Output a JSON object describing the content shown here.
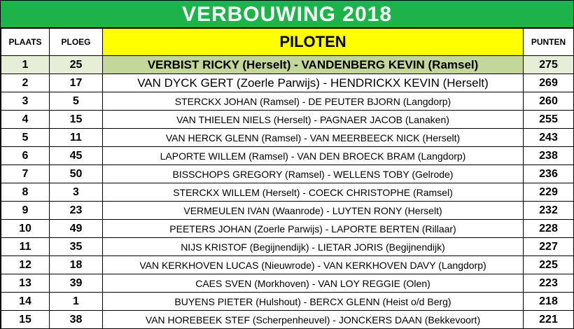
{
  "title": "VERBOUWING  2018",
  "headers": {
    "plaats": "PLAATS",
    "ploeg": "PLOEG",
    "piloten": "PILOTEN",
    "punten": "PUNTEN"
  },
  "rows": [
    {
      "plaats": "1",
      "ploeg": "25",
      "piloten": "VERBIST  RICKY  (Herselt) - VANDENBERG  KEVIN  (Ramsel)",
      "punten": "275"
    },
    {
      "plaats": "2",
      "ploeg": "17",
      "piloten": "VAN DYCK  GERT  (Zoerle Parwijs) - HENDRICKX  KEVIN  (Herselt)",
      "punten": "269"
    },
    {
      "plaats": "3",
      "ploeg": "5",
      "piloten": "STERCKX  JOHAN  (Ramsel) - DE PEUTER  BJORN  (Langdorp)",
      "punten": "260"
    },
    {
      "plaats": "4",
      "ploeg": "15",
      "piloten": "VAN THIELEN  NIELS  (Herselt) - PAGNAER  JACOB  (Lanaken)",
      "punten": "255"
    },
    {
      "plaats": "5",
      "ploeg": "11",
      "piloten": "VAN HERCK  GLENN  (Ramsel) - VAN MEERBEECK  NICK  (Herselt)",
      "punten": "243"
    },
    {
      "plaats": "6",
      "ploeg": "45",
      "piloten": "LAPORTE  WILLEM  (Ramsel) - VAN DEN BROECK  BRAM  (Langdorp)",
      "punten": "238"
    },
    {
      "plaats": "7",
      "ploeg": "50",
      "piloten": "BISSCHOPS  GREGORY  (Ramsel) - WELLENS  TOBY  (Gelrode)",
      "punten": "236"
    },
    {
      "plaats": "8",
      "ploeg": "3",
      "piloten": "STERCKX  WILLEM  (Herselt) - COECK  CHRISTOPHE  (Ramsel)",
      "punten": "229"
    },
    {
      "plaats": "9",
      "ploeg": "23",
      "piloten": "VERMEULEN  IVAN  (Waanrode) - LUYTEN  RONY  (Herselt)",
      "punten": "232"
    },
    {
      "plaats": "10",
      "ploeg": "49",
      "piloten": "PEETERS  JOHAN  (Zoerle Parwijs) - LAPORTE  BERTEN  (Rillaar)",
      "punten": "228"
    },
    {
      "plaats": "11",
      "ploeg": "35",
      "piloten": "NIJS  KRISTOF  (Begijnendijk) - LIETAR  JORIS  (Begijnendijk)",
      "punten": "227"
    },
    {
      "plaats": "12",
      "ploeg": "18",
      "piloten": "VAN KERKHOVEN  LUCAS  (Nieuwrode) - VAN KERKHOVEN  DAVY  (Langdorp)",
      "punten": "225"
    },
    {
      "plaats": "13",
      "ploeg": "39",
      "piloten": "CAES  SVEN  (Morkhoven) - VAN LOY  REGGIE  (Olen)",
      "punten": "223"
    },
    {
      "plaats": "14",
      "ploeg": "1",
      "piloten": "BUYENS  PIETER  (Hulshout) - BERCX  GLENN  (Heist o/d Berg)",
      "punten": "218"
    },
    {
      "plaats": "15",
      "ploeg": "38",
      "piloten": "VAN HOREBEEK  STEF  (Scherpenheuvel) - JONCKERS  DAAN  (Bekkevoort)",
      "punten": "221"
    }
  ],
  "colors": {
    "title_background": "#1db24a",
    "title_text": "#ffffff",
    "piloten_header": "#ffff00",
    "first_place_pilot_cell": "#c4d79b"
  }
}
